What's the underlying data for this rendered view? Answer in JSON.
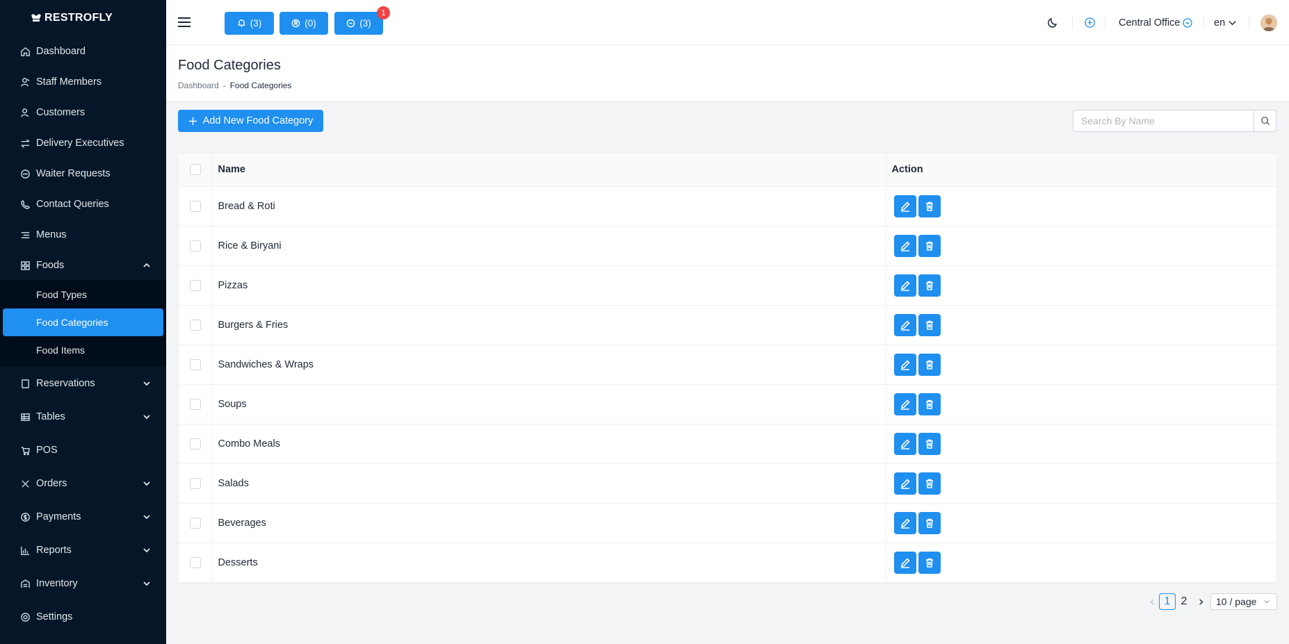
{
  "brand": {
    "name": "RESTROFLY"
  },
  "sidebar": {
    "items": [
      {
        "label": "Dashboard",
        "icon": "home-icon"
      },
      {
        "label": "Staff Members",
        "icon": "users-icon"
      },
      {
        "label": "Customers",
        "icon": "customers-icon"
      },
      {
        "label": "Delivery Executives",
        "icon": "swap-icon"
      },
      {
        "label": "Waiter Requests",
        "icon": "chat-icon"
      },
      {
        "label": "Contact Queries",
        "icon": "phone-icon"
      },
      {
        "label": "Menus",
        "icon": "menu-icon"
      },
      {
        "label": "Foods",
        "icon": "grid-icon"
      },
      {
        "label": "Reservations",
        "icon": "book-icon"
      },
      {
        "label": "Tables",
        "icon": "table-icon"
      },
      {
        "label": "POS",
        "icon": "cart-icon"
      },
      {
        "label": "Orders",
        "icon": "orders-icon"
      },
      {
        "label": "Payments",
        "icon": "dollar-icon"
      },
      {
        "label": "Reports",
        "icon": "chart-icon"
      },
      {
        "label": "Inventory",
        "icon": "inventory-icon"
      },
      {
        "label": "Settings",
        "icon": "gear-icon"
      }
    ],
    "foods_sub": [
      {
        "label": "Food Types"
      },
      {
        "label": "Food Categories"
      },
      {
        "label": "Food Items"
      }
    ]
  },
  "header": {
    "pills": [
      {
        "label": "(3)",
        "icon": "bell-icon"
      },
      {
        "label": "(0)",
        "icon": "reservation-icon"
      },
      {
        "label": "(3)",
        "icon": "waiter-icon",
        "badge": "1"
      }
    ],
    "office": "Central Office",
    "language": "en"
  },
  "page": {
    "title": "Food Categories",
    "breadcrumb": {
      "home": "Dashboard",
      "separator": "-",
      "current": "Food Categories"
    }
  },
  "toolbar": {
    "add_label": "Add New Food Category",
    "search_placeholder": "Search By Name"
  },
  "table": {
    "headers": {
      "name": "Name",
      "action": "Action"
    },
    "rows": [
      {
        "name": "Bread & Roti"
      },
      {
        "name": "Rice & Biryani"
      },
      {
        "name": "Pizzas"
      },
      {
        "name": "Burgers & Fries"
      },
      {
        "name": "Sandwiches & Wraps"
      },
      {
        "name": "Soups"
      },
      {
        "name": "Combo Meals"
      },
      {
        "name": "Salads"
      },
      {
        "name": "Beverages"
      },
      {
        "name": "Desserts"
      }
    ]
  },
  "pagination": {
    "pages": [
      "1",
      "2"
    ],
    "current": "1",
    "page_size": "10 / page"
  },
  "colors": {
    "primary": "#1f8ff0",
    "sidebar_bg": "#041628",
    "badge": "#ef4444"
  }
}
